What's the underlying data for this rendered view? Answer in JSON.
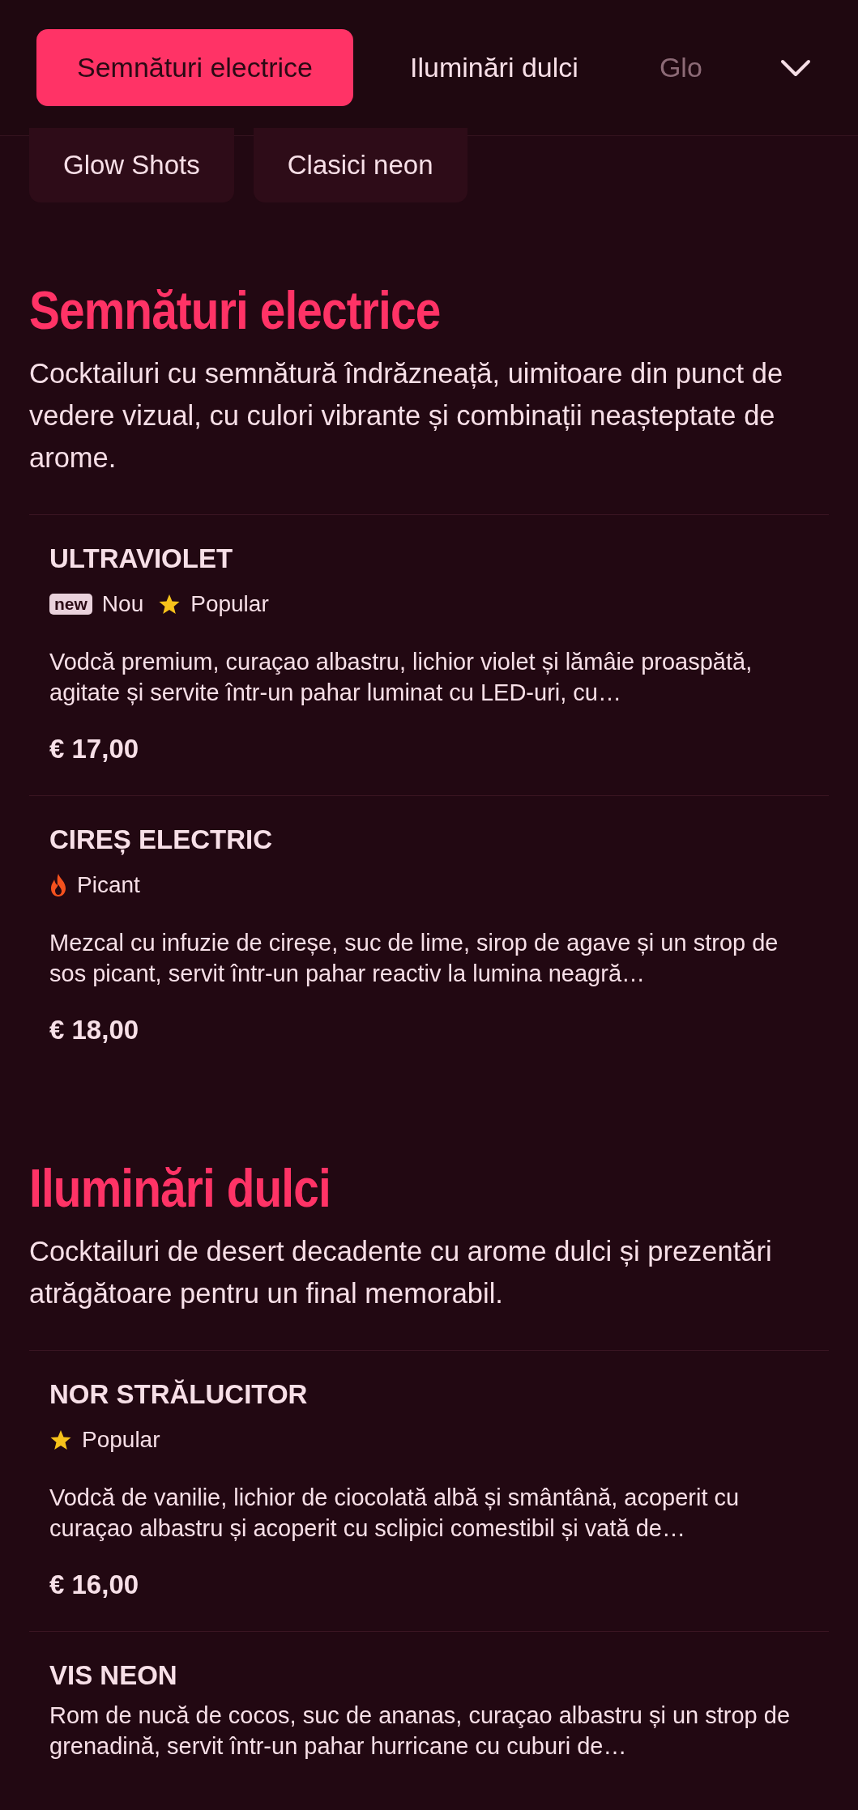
{
  "category_tabs": [
    {
      "label": "Semnături electrice",
      "selected": true
    },
    {
      "label": "Iluminări dulci",
      "selected": false
    },
    {
      "label": "Glo",
      "selected": false
    }
  ],
  "category_pills": [
    {
      "label": "Glow Shots",
      "selected": false
    },
    {
      "label": "Clasici neon",
      "selected": false
    }
  ],
  "sections": [
    {
      "title": "Semnături electrice",
      "description": "Cocktailuri cu semnătură îndrăzneață, uimitoare din punct de vedere vizual, cu culori vibrante și combinații neașteptate de arome.",
      "items": [
        {
          "name": "ULTRAVIOLET",
          "tags": [
            {
              "kind": "new",
              "badge": "new",
              "label": "Nou"
            },
            {
              "kind": "popular",
              "label": "Popular"
            }
          ],
          "description": "Vodcă premium, curaçao albastru, lichior violet și lămâie proaspătă, agitate și servite într-un pahar luminat cu LED-uri, cu…",
          "price": "€ 17,00"
        },
        {
          "name": "CIREȘ ELECTRIC",
          "tags": [
            {
              "kind": "spicy",
              "label": "Picant"
            }
          ],
          "description": "Mezcal cu infuzie de cireșe, suc de lime, sirop de agave și un strop de sos picant, servit într-un pahar reactiv la lumina neagră…",
          "price": "€ 18,00"
        }
      ]
    },
    {
      "title": "Iluminări dulci",
      "description": "Cocktailuri de desert decadente cu arome dulci și prezentări atrăgătoare pentru un final memorabil.",
      "items": [
        {
          "name": "NOR STRĂLUCITOR",
          "tags": [
            {
              "kind": "popular",
              "label": "Popular"
            }
          ],
          "description": "Vodcă de vanilie, lichior de ciocolată albă și smântână, acoperit cu curaçao albastru și acoperit cu sclipici comestibil și vată de…",
          "price": "€ 16,00"
        },
        {
          "name": "VIS NEON",
          "description": "Rom de nucă de cocos, suc de ananas, curaçao albastru și un strop de grenadină, servit într-un pahar hurricane cu cuburi de…"
        }
      ]
    }
  ]
}
